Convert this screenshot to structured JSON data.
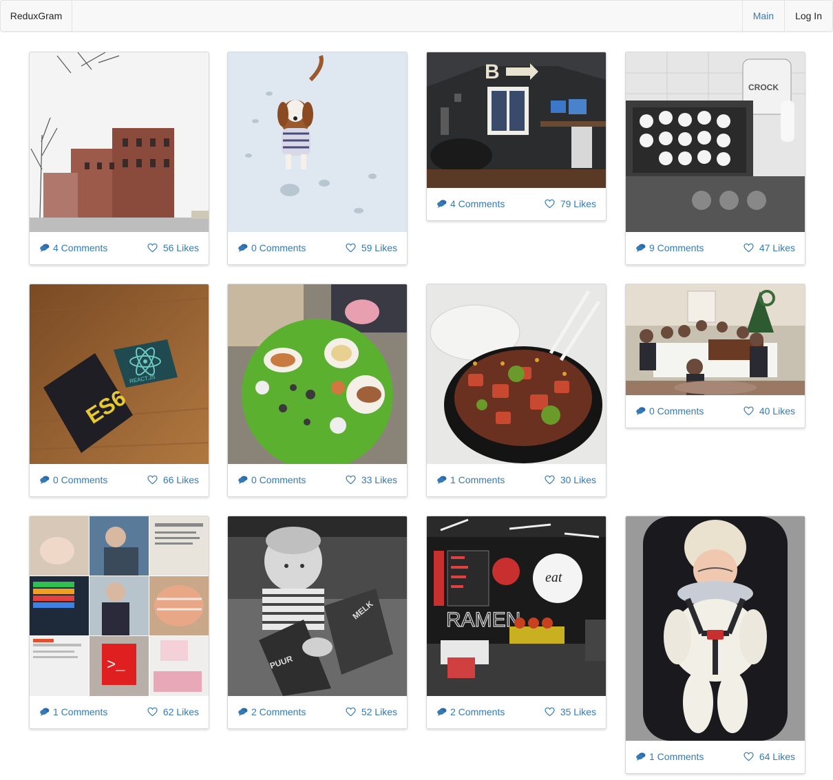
{
  "navbar": {
    "brand": "ReduxGram",
    "links": {
      "main": "Main",
      "login": "Log In"
    }
  },
  "colors": {
    "link": "#337ab7",
    "navbar_bg": "#f8f8f8"
  },
  "posts": [
    {
      "comments": "4 Comments",
      "likes": "56 Likes",
      "photo": "snowy street with brick buildings"
    },
    {
      "comments": "0 Comments",
      "likes": "59 Likes",
      "photo": "puppy in sweater on snow"
    },
    {
      "comments": "4 Comments",
      "likes": "79 Likes",
      "photo": "home office with desk and monitors"
    },
    {
      "comments": "9 Comments",
      "likes": "47 Likes",
      "photo": "pancakes on griddle, black and white"
    },
    {
      "comments": "0 Comments",
      "likes": "66 Likes",
      "photo": "ES6 and React.js stickers on wood"
    },
    {
      "comments": "0 Comments",
      "likes": "33 Likes",
      "photo": "food on green round table"
    },
    {
      "comments": "1 Comments",
      "likes": "30 Likes",
      "photo": "poke bowl with chopsticks"
    },
    {
      "comments": "0 Comments",
      "likes": "40 Likes",
      "photo": "family dinner table"
    },
    {
      "comments": "1 Comments",
      "likes": "62 Likes",
      "photo": "photo collage grid"
    },
    {
      "comments": "2 Comments",
      "likes": "52 Likes",
      "photo": "baby with milk cartons, black and white"
    },
    {
      "comments": "2 Comments",
      "likes": "35 Likes",
      "photo": "ramen restaurant interior"
    },
    {
      "comments": "1 Comments",
      "likes": "64 Likes",
      "photo": "baby in white snowsuit in stroller"
    }
  ]
}
